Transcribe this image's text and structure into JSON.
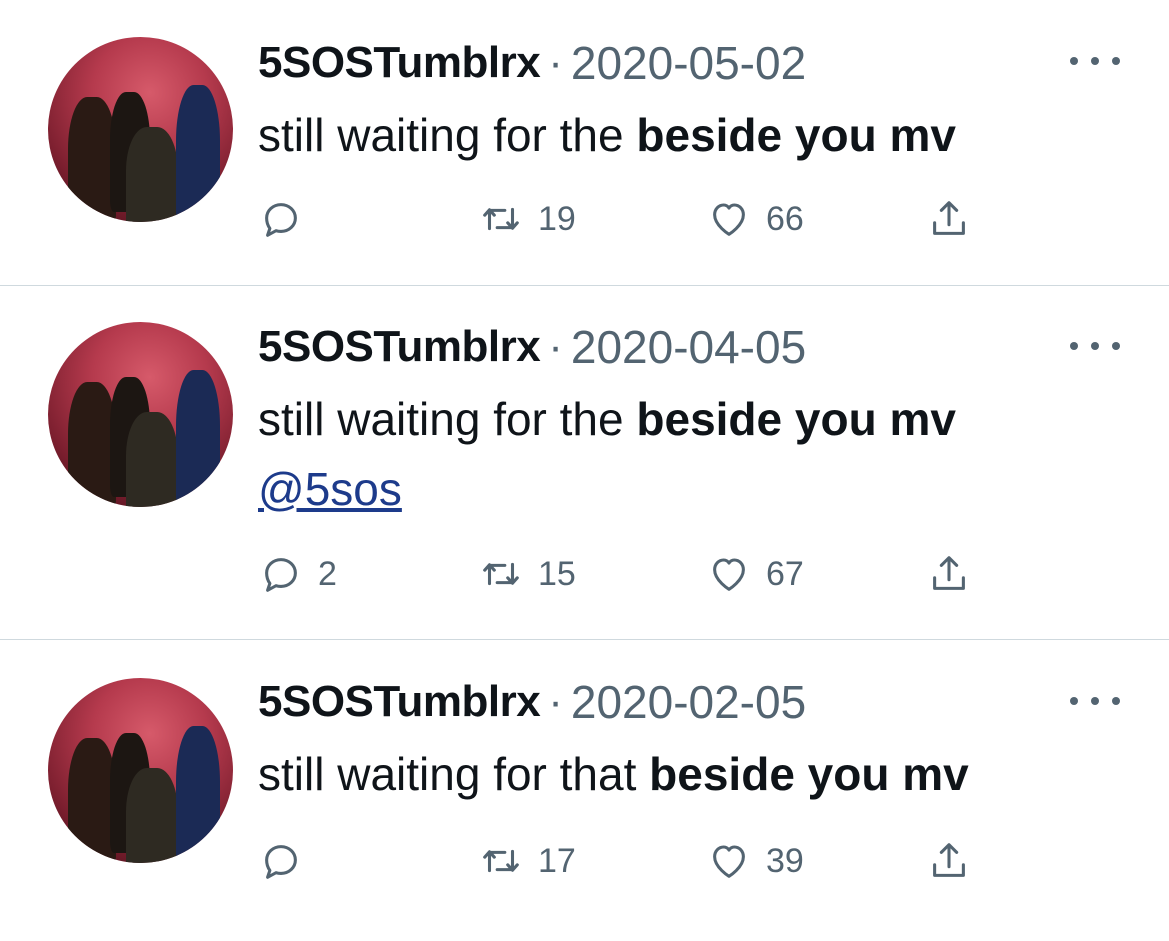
{
  "tweets": [
    {
      "username": "5SOSTumblrx",
      "separator": "·",
      "date": "2020-05-02",
      "text_plain": "still waiting for the ",
      "text_bold": "beside you mv",
      "mention": "",
      "reply_count": "",
      "retweet_count": "19",
      "like_count": "66"
    },
    {
      "username": "5SOSTumblrx",
      "separator": "·",
      "date": "2020-04-05",
      "text_plain": "still waiting for the ",
      "text_bold": "beside you mv",
      "mention": "@5sos",
      "reply_count": "2",
      "retweet_count": "15",
      "like_count": "67"
    },
    {
      "username": "5SOSTumblrx",
      "separator": "·",
      "date": "2020-02-05",
      "text_plain": "still waiting for that ",
      "text_bold": "beside you mv",
      "mention": "",
      "reply_count": "",
      "retweet_count": "17",
      "like_count": "39"
    }
  ],
  "icons": [
    "reply-icon",
    "retweet-icon",
    "like-icon",
    "share-icon",
    "more-icon"
  ],
  "colors": {
    "text": "#0f1419",
    "secondary": "#536471",
    "mention": "#1d3b8b",
    "divider": "#cfd9de",
    "avatar_tint": "#b53a4d"
  }
}
